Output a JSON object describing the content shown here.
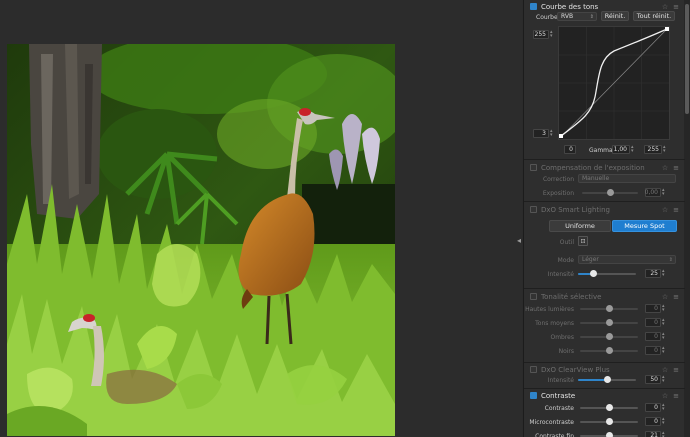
{
  "viewer": {
    "handle_glyph": "◂"
  },
  "tone_curve": {
    "title": "Courbe des tons",
    "channel_label": "Courbe",
    "channel_value": "RVB",
    "reset_label": "Réinit.",
    "reset_all_label": "Tout réinit.",
    "output_max": "255",
    "output_min": "3",
    "input_min": "0",
    "gamma_label": "Gamma",
    "gamma_value": "1,00",
    "input_max": "255"
  },
  "exposure": {
    "title": "Compensation de l'exposition",
    "correction_label": "Correction",
    "correction_value": "Manuelle",
    "exposure_label": "Exposition",
    "exposure_value": "0,00",
    "exposure_level": 0.5
  },
  "smart_lighting": {
    "title": "DxO Smart Lighting",
    "uniform_label": "Uniforme",
    "spot_label": "Mesure Spot",
    "tool_label": "Outil",
    "mode_label": "Mode",
    "mode_value": "Léger",
    "intensity_label": "Intensité",
    "intensity_value": "25",
    "intensity_level": 0.25
  },
  "selective_tone": {
    "title": "Tonalité sélective",
    "rows": [
      {
        "label": "Hautes lumières",
        "value": "0"
      },
      {
        "label": "Tons moyens",
        "value": "0"
      },
      {
        "label": "Ombres",
        "value": "0"
      },
      {
        "label": "Noirs",
        "value": "0"
      }
    ]
  },
  "clearview": {
    "title": "DxO ClearView Plus",
    "intensity_label": "Intensité",
    "intensity_value": "50",
    "intensity_level": 0.5
  },
  "contrast": {
    "title": "Contraste",
    "rows": [
      {
        "label": "Contraste",
        "value": "0"
      },
      {
        "label": "Microcontraste",
        "value": "0"
      },
      {
        "label": "Contraste fin",
        "value": "21"
      }
    ]
  },
  "icons": [
    "star-icon",
    "menu-icon",
    "checkbox-icon",
    "spot-picker-icon",
    "dropper-icon"
  ],
  "colors": {
    "accent": "#1f7ed0",
    "panel_bg": "#2e2e2e",
    "viewer_bg": "#2c2c2c"
  }
}
